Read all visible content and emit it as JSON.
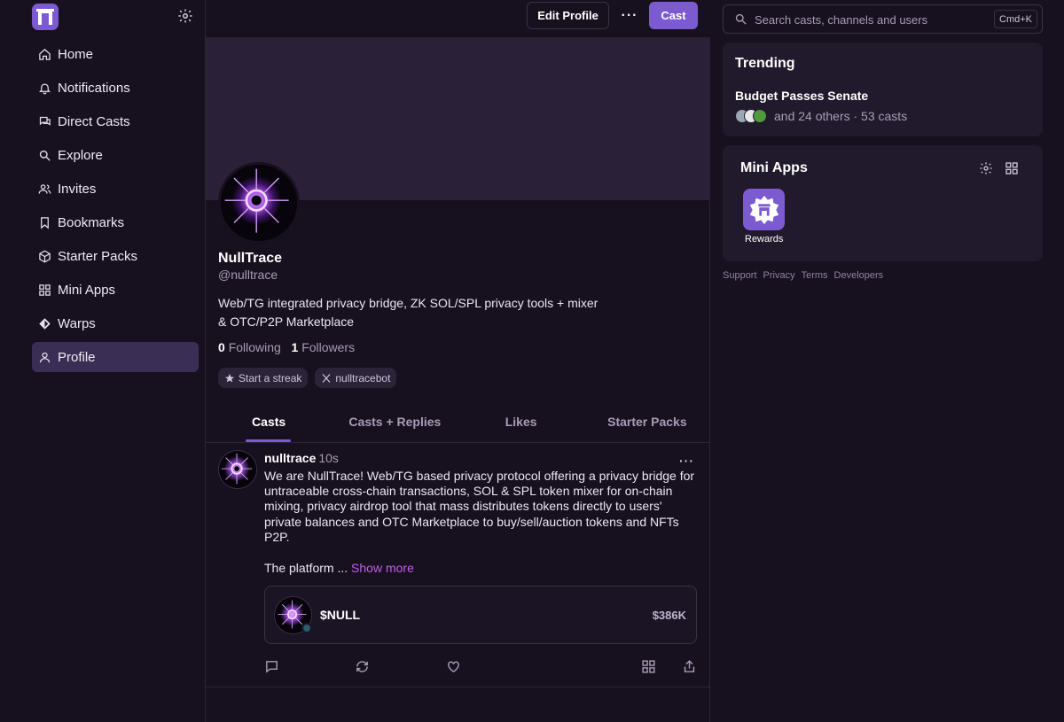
{
  "sidebar": {
    "items": [
      {
        "label": "Home",
        "icon": "home-icon"
      },
      {
        "label": "Notifications",
        "icon": "bell-icon"
      },
      {
        "label": "Direct Casts",
        "icon": "chat-bubbles-icon"
      },
      {
        "label": "Explore",
        "icon": "search-icon"
      },
      {
        "label": "Invites",
        "icon": "users-icon"
      },
      {
        "label": "Bookmarks",
        "icon": "bookmark-icon"
      },
      {
        "label": "Starter Packs",
        "icon": "package-icon"
      },
      {
        "label": "Mini Apps",
        "icon": "grid-icon"
      },
      {
        "label": "Warps",
        "icon": "diamond-icon"
      },
      {
        "label": "Profile",
        "icon": "user-icon"
      }
    ],
    "active": "Profile"
  },
  "header": {
    "edit_profile": "Edit Profile",
    "more": "···",
    "cast": "Cast"
  },
  "profile": {
    "name": "NullTrace",
    "handle": "@nulltrace",
    "bio": "Web/TG integrated privacy bridge, ZK SOL/SPL privacy tools + mixer & OTC/P2P Marketplace",
    "following_count": "0",
    "following_label": "Following",
    "followers_count": "1",
    "followers_label": "Followers",
    "chips": [
      "Start a streak",
      "nulltracebot"
    ]
  },
  "tabs": [
    "Casts",
    "Casts + Replies",
    "Likes",
    "Starter Packs"
  ],
  "active_tab": "Casts",
  "cast": {
    "author": "nulltrace",
    "time": "10s",
    "text": "We are NullTrace! Web/TG based privacy protocol offering a privacy bridge for untraceable cross-chain transactions, SOL & SPL token mixer for on-chain mixing, privacy airdrop tool that mass distributes tokens directly to users' private balances and OTC Marketplace to buy/sell/auction tokens and NFTs P2P.",
    "text_more": "The platform ...",
    "show_more": "Show more",
    "token": {
      "name": "$NULL",
      "value": "$386K"
    }
  },
  "search": {
    "placeholder": "Search casts, channels and users",
    "shortcut": "Cmd+K"
  },
  "trending": {
    "title": "Trending",
    "topic": "Budget Passes Senate",
    "meta": "and 24 others · 53 casts"
  },
  "mini_apps": {
    "title": "Mini Apps",
    "apps": [
      {
        "label": "Rewards"
      }
    ]
  },
  "footer": [
    "Support",
    "Privacy",
    "Terms",
    "Developers"
  ],
  "colors": {
    "accent": "#7c5bd1",
    "background": "#17101f",
    "card": "#211a2c",
    "link": "#c45cf0"
  }
}
